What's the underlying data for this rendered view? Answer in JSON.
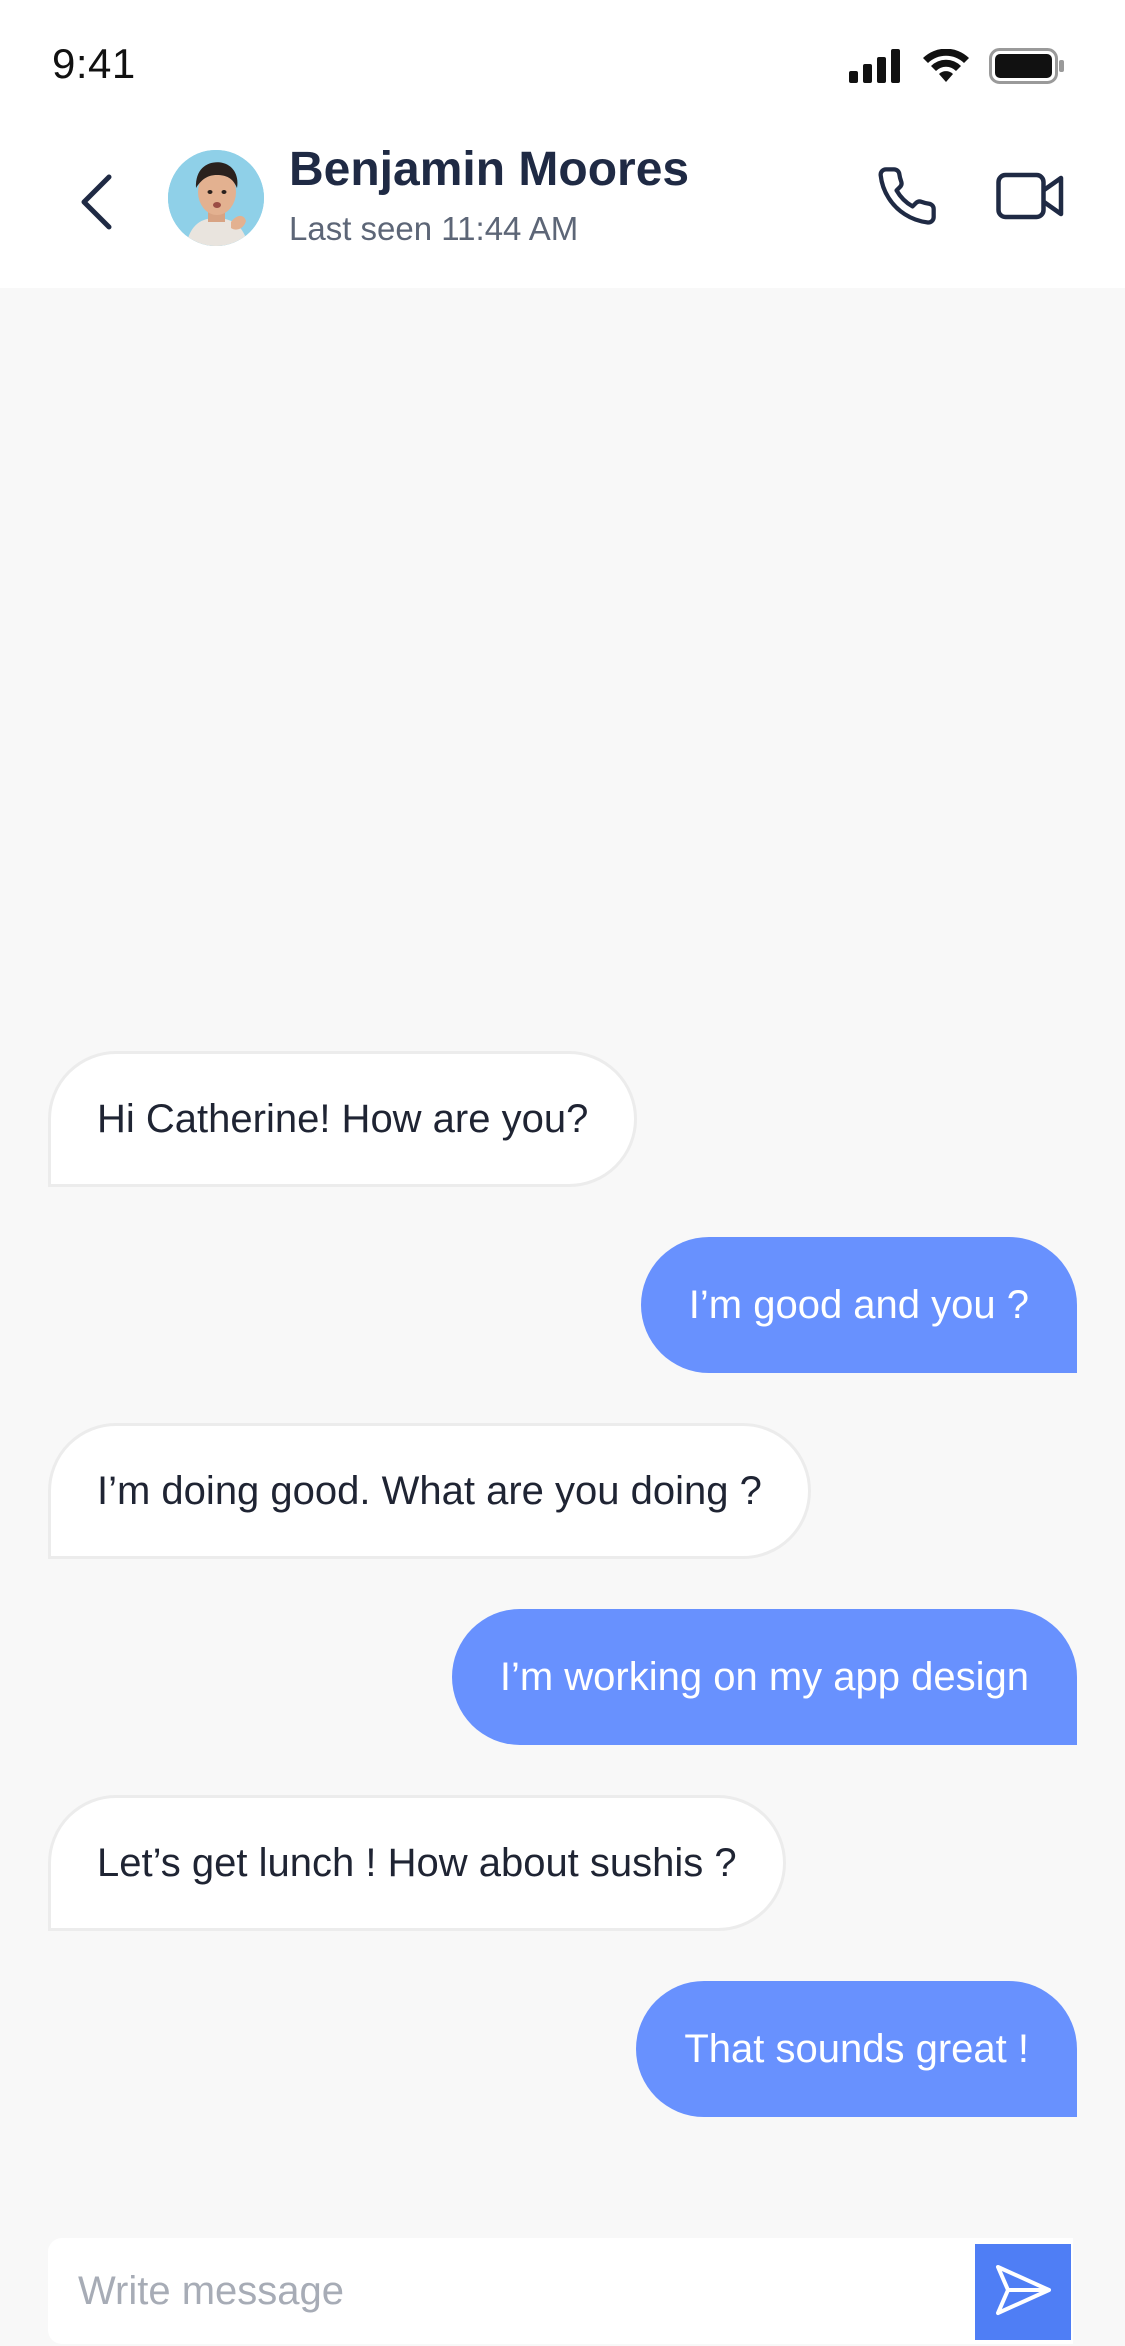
{
  "status_bar": {
    "time": "9:41"
  },
  "header": {
    "contact_name": "Benjamin Moores",
    "last_seen": "Last seen 11:44 AM"
  },
  "messages": [
    {
      "direction": "incoming",
      "text": "Hi Catherine! How are you?"
    },
    {
      "direction": "outgoing",
      "text": "I’m good and you ?"
    },
    {
      "direction": "incoming",
      "text": "I’m doing good. What are you doing ?"
    },
    {
      "direction": "outgoing",
      "text": "I’m working on my app design"
    },
    {
      "direction": "incoming",
      "text": "Let’s get lunch ! How about sushis ?"
    },
    {
      "direction": "outgoing",
      "text": "That sounds great !"
    }
  ],
  "composer": {
    "placeholder": "Write message",
    "value": ""
  },
  "icons": {
    "back": "chevron-left-icon",
    "call": "phone-icon",
    "video": "video-camera-icon",
    "send": "send-icon",
    "signal": "cellular-signal-icon",
    "wifi": "wifi-icon",
    "battery": "battery-icon"
  },
  "colors": {
    "accent": "#6891fe",
    "send_button": "#4f7ef5",
    "background": "#f8f8f8",
    "incoming_bubble": "#ffffff",
    "outgoing_text": "#ffffff"
  }
}
